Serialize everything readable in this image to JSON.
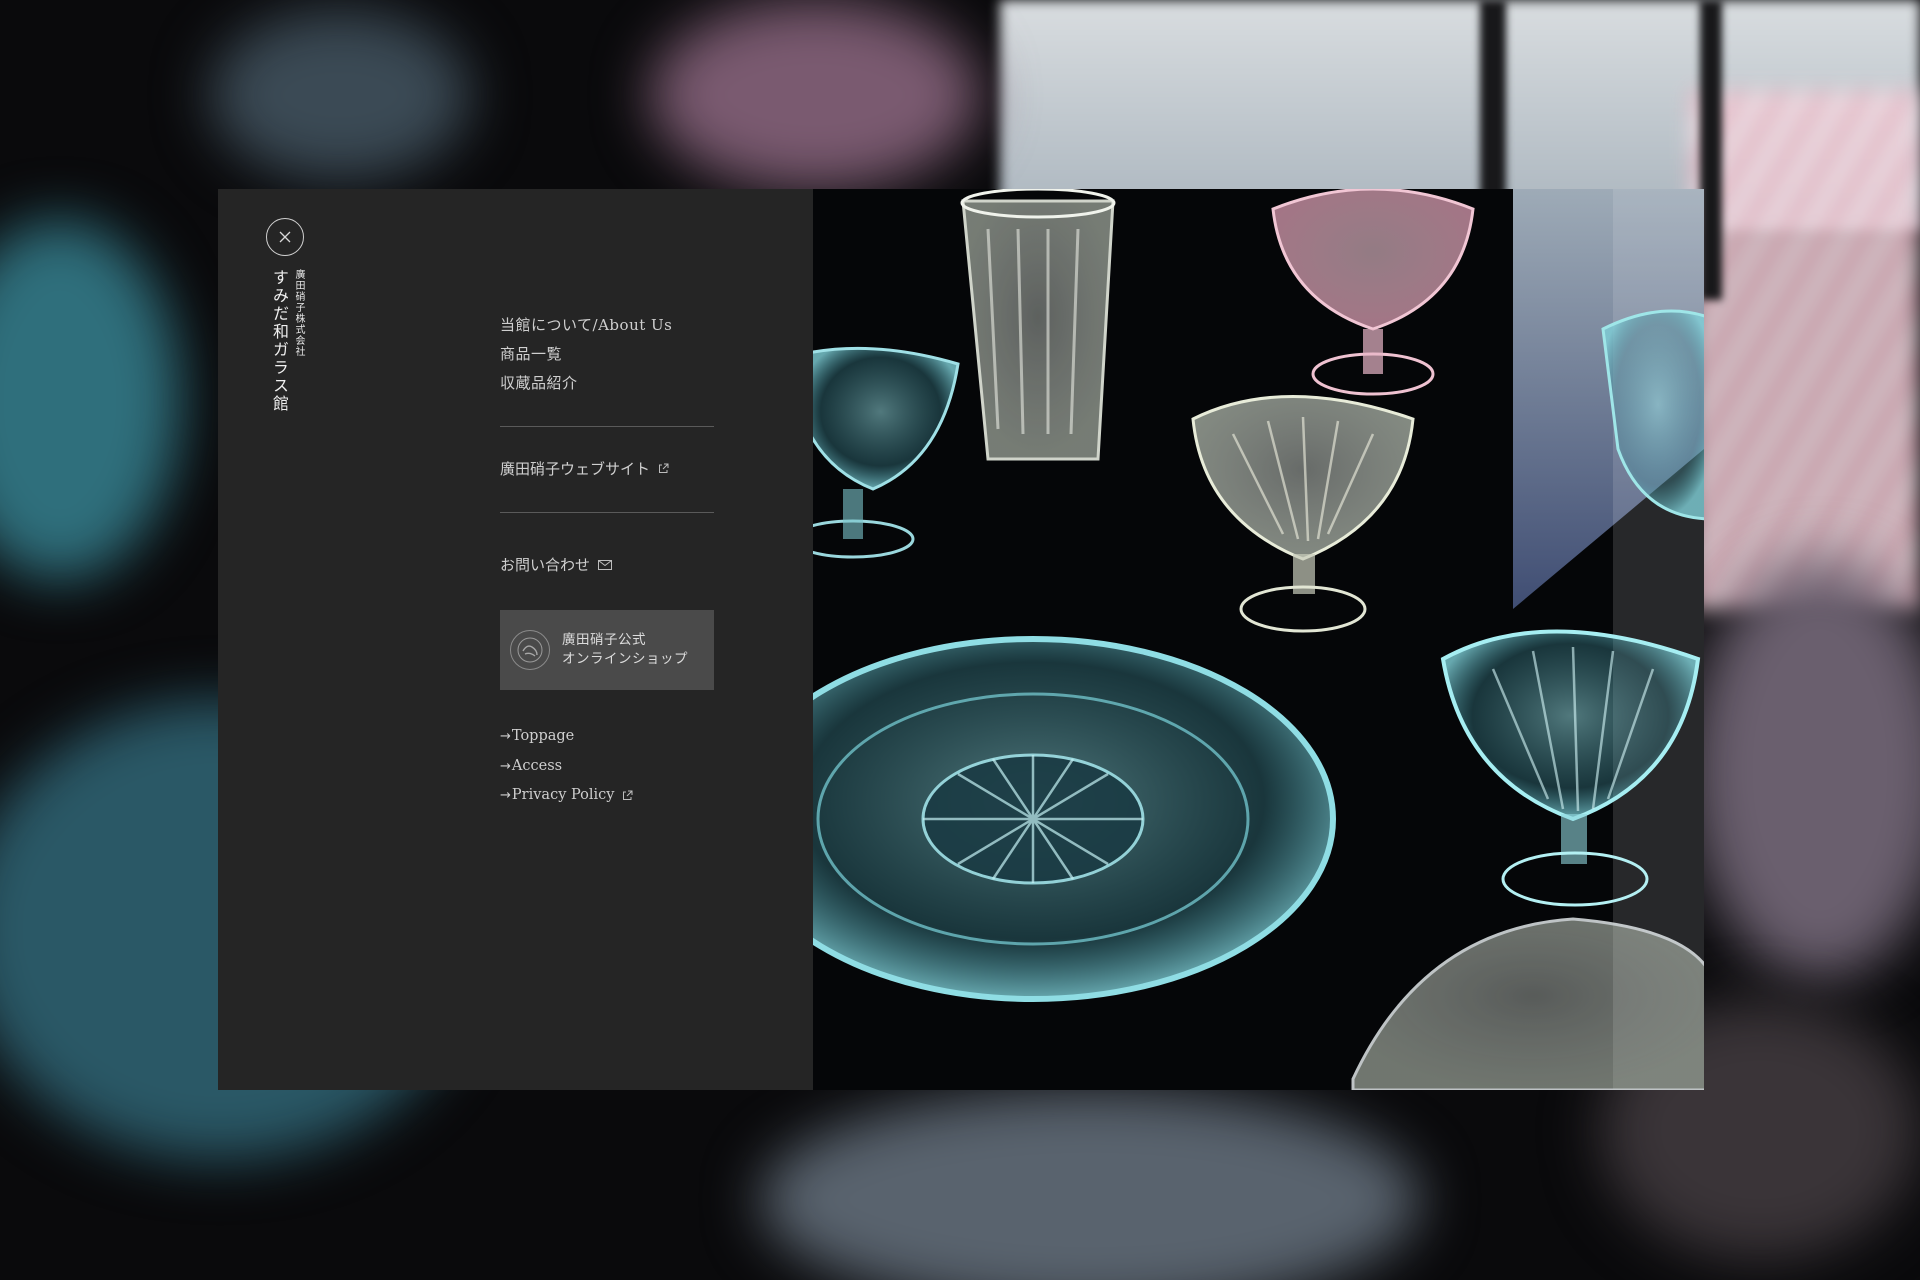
{
  "logo": {
    "company": "廣田硝子株式会社",
    "name": "すみだ和ガラス館"
  },
  "nav": {
    "primary": [
      "当館について/About Us",
      "商品一覧",
      "収蔵品紹介"
    ],
    "website_link": "廣田硝子ウェブサイト",
    "contact_link": "お問い合わせ",
    "shop_button": {
      "line1": "廣田硝子公式",
      "line2": "オンラインショップ"
    },
    "footer_links": [
      "Toppage",
      "Access",
      "Privacy Policy"
    ]
  },
  "icons": {
    "close": "close-icon",
    "external": "external-link-icon",
    "mail": "mail-icon",
    "arrow": "arrow-right-icon",
    "shop_logo": "shop-logo-icon"
  },
  "colors": {
    "menu_bg": "#252525",
    "text": "#cfcfcf",
    "divider": "#5a5a5a",
    "shop_button_bg": "#4a4a4a"
  }
}
